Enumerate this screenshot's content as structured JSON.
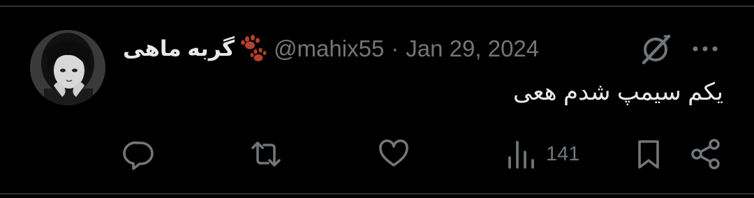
{
  "tweet": {
    "author": {
      "display_name": "گربه ماهی",
      "name_emoji": "paw-prints",
      "handle": "@mahix55",
      "avatar": "profile-photo"
    },
    "separator": "·",
    "date": "Jan 29, 2024",
    "text": "یکم سیمپ شدم هعی",
    "actions": {
      "reply_icon": "reply-icon",
      "retweet_icon": "retweet-icon",
      "like_icon": "heart-icon",
      "views_icon": "views-icon",
      "views_count": "141",
      "bookmark_icon": "bookmark-icon",
      "share_icon": "share-icon"
    },
    "top_icons": [
      "grok-icon",
      "more-icon"
    ]
  },
  "colors": {
    "background": "#000000",
    "text_primary": "#e7e9ea",
    "text_secondary": "#71767b",
    "divider": "#2f3336",
    "paw": "#b5402c"
  }
}
